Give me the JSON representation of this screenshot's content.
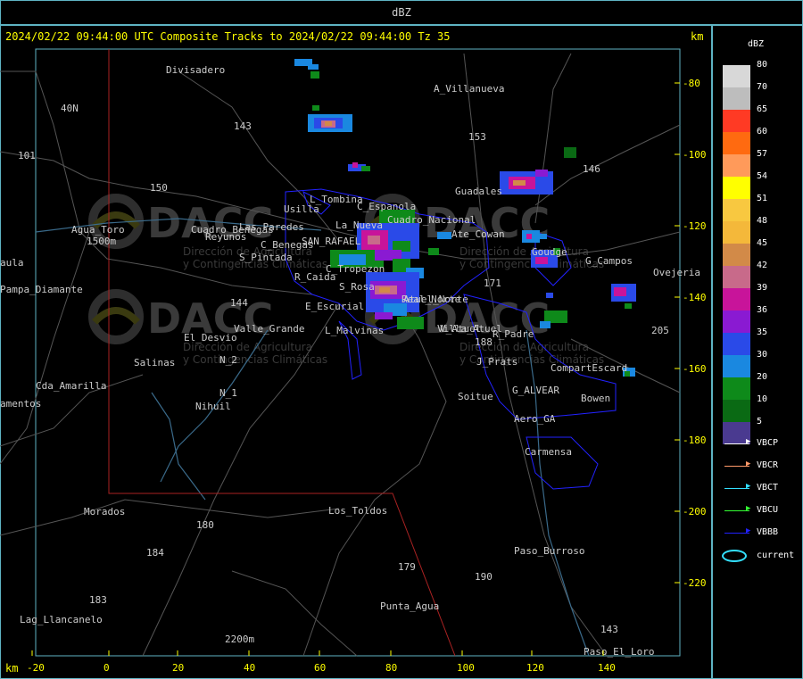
{
  "window": {
    "title": "dBZ"
  },
  "header": {
    "text": "2024/02/22 09:44:00 UTC Composite Tracks to 2024/02/22 09:44:00 Tz 35",
    "km_top": "km",
    "km_bottom": "km"
  },
  "colors": {
    "frame": "#5fb4c4",
    "header_text": "#ffff00",
    "place_text": "#cccccc",
    "road": "#555555",
    "blue_boundary": "#2222ff",
    "red_boundary": "#aa2222",
    "river": "#3a6a8a"
  },
  "y_axis": {
    "labels": [
      "-80",
      "-100",
      "-120",
      "-140",
      "-160",
      "-180",
      "-200",
      "-220"
    ]
  },
  "x_axis": {
    "labels": [
      "-20",
      "0",
      "20",
      "40",
      "60",
      "80",
      "100",
      "120",
      "140"
    ]
  },
  "legend": {
    "title": "dBZ",
    "scale": [
      {
        "value": "80",
        "color": "#d8d8d8"
      },
      {
        "value": "70",
        "color": "#bdbdbd"
      },
      {
        "value": "65",
        "color": "#ff3a24"
      },
      {
        "value": "60",
        "color": "#ff6a10"
      },
      {
        "value": "57",
        "color": "#ff9a5a"
      },
      {
        "value": "54",
        "color": "#ffff00"
      },
      {
        "value": "51",
        "color": "#f8c840"
      },
      {
        "value": "48",
        "color": "#f4b83a"
      },
      {
        "value": "45",
        "color": "#d28a48"
      },
      {
        "value": "42",
        "color": "#c86a8a"
      },
      {
        "value": "39",
        "color": "#c8149a"
      },
      {
        "value": "36",
        "color": "#8a1ad2"
      },
      {
        "value": "35",
        "color": "#2a4ae8"
      },
      {
        "value": "30",
        "color": "#1a88e0"
      },
      {
        "value": "20",
        "color": "#0e8a1a"
      },
      {
        "value": "10",
        "color": "#0a6a14"
      },
      {
        "value": "5",
        "color": "#4a3a90"
      }
    ],
    "tracks": [
      {
        "label": "VBCP",
        "color": "#ffffff"
      },
      {
        "label": "VBCR",
        "color": "#ff9a6a"
      },
      {
        "label": "VBCT",
        "color": "#33e0ff"
      },
      {
        "label": "VBCU",
        "color": "#33ff33"
      },
      {
        "label": "VBBB",
        "color": "#2222ff"
      }
    ],
    "current": {
      "label": "current",
      "color": "#33e0ff"
    }
  },
  "places": [
    {
      "name": "Divisadero"
    },
    {
      "name": "A_Villanueva"
    },
    {
      "name": "153"
    },
    {
      "name": "143"
    },
    {
      "name": "40N"
    },
    {
      "name": "101"
    },
    {
      "name": "150"
    },
    {
      "name": "146"
    },
    {
      "name": "Guadales"
    },
    {
      "name": "L_Tombina"
    },
    {
      "name": "C_Espanola"
    },
    {
      "name": "Usilla"
    },
    {
      "name": "Agua_Toro"
    },
    {
      "name": "1500m"
    },
    {
      "name": "Reyunos"
    },
    {
      "name": "S_Pintada"
    },
    {
      "name": "La_Nueva"
    },
    {
      "name": "Las_Paredes"
    },
    {
      "name": "SAN_RAFAEL"
    },
    {
      "name": "C_Benegas"
    },
    {
      "name": "Cuadro_Nacional"
    },
    {
      "name": "C_Tropezon"
    },
    {
      "name": "R_Caida"
    },
    {
      "name": "S_Rosa"
    },
    {
      "name": "Real_Norte"
    },
    {
      "name": "E_Escurial"
    },
    {
      "name": "L_Malvinas"
    },
    {
      "name": "V_Atuel"
    },
    {
      "name": "R_Padre"
    },
    {
      "name": "G_Campos"
    },
    {
      "name": "Ovejeria"
    },
    {
      "name": "El_Desvio"
    },
    {
      "name": "Valle_Grande"
    },
    {
      "name": "Salinas"
    },
    {
      "name": "N_2"
    },
    {
      "name": "N_1"
    },
    {
      "name": "Nihuil"
    },
    {
      "name": "Cda_Amarilla"
    },
    {
      "name": "amentos"
    },
    {
      "name": "J_Prats"
    },
    {
      "name": "CompartEscard"
    },
    {
      "name": "G_ALVEAR"
    },
    {
      "name": "Bowen"
    },
    {
      "name": "Soitue"
    },
    {
      "name": "Aero_GA"
    },
    {
      "name": "Carmensa"
    },
    {
      "name": "Morados"
    },
    {
      "name": "Los_Toldos"
    },
    {
      "name": "180"
    },
    {
      "name": "184"
    },
    {
      "name": "179"
    },
    {
      "name": "190"
    },
    {
      "name": "Paso_Burroso"
    },
    {
      "name": "183"
    },
    {
      "name": "Lag_Llancanelo"
    },
    {
      "name": "Punta_Agua"
    },
    {
      "name": "2200m"
    },
    {
      "name": "Paso_El_Loro"
    },
    {
      "name": "143"
    },
    {
      "name": "205"
    },
    {
      "name": "Pampa_Diamante"
    },
    {
      "name": "aula"
    },
    {
      "name": "144"
    },
    {
      "name": "188"
    },
    {
      "name": "171"
    },
    {
      "name": "Ate_Cowan"
    },
    {
      "name": "Goudge"
    },
    {
      "name": "Cuadro_Benegas"
    },
    {
      "name": "Villa_Atuel"
    },
    {
      "name": "Atuel_Norte"
    }
  ],
  "watermark": {
    "logo": "DACC",
    "line1": "Dirección de Agricultura",
    "line2": "y Contingencias Climáticas"
  }
}
